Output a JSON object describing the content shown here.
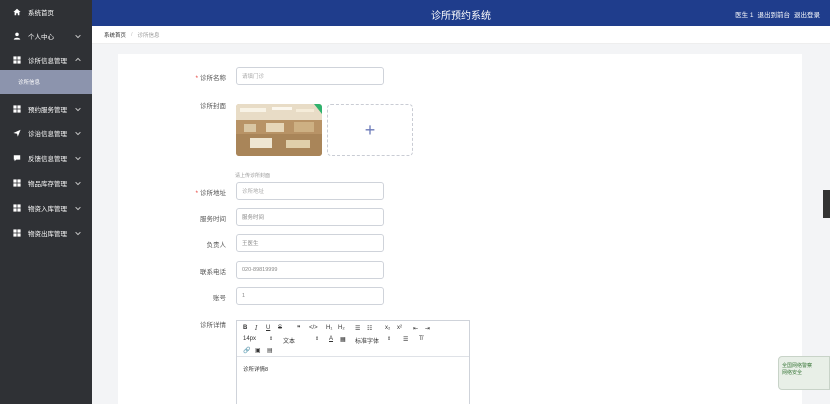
{
  "header": {
    "title": "诊所预约系统",
    "user": "医生 1",
    "to_frontend": "退出到前台",
    "logout": "退出登录"
  },
  "sidebar": {
    "items": [
      {
        "label": "系统首页",
        "icon": "home-icon"
      },
      {
        "label": "个人中心",
        "icon": "user-icon"
      },
      {
        "label": "诊所信息管理",
        "icon": "grid-icon"
      },
      {
        "label": "预约服务管理",
        "icon": "grid-icon"
      },
      {
        "label": "诊治信息管理",
        "icon": "send-icon"
      },
      {
        "label": "反馈信息管理",
        "icon": "chat-icon"
      },
      {
        "label": "物品库存管理",
        "icon": "grid-icon"
      },
      {
        "label": "物资入库管理",
        "icon": "grid-icon"
      },
      {
        "label": "物资出库管理",
        "icon": "grid-icon"
      }
    ],
    "sub_active": "诊所信息"
  },
  "breadcrumb": {
    "first": "系统首页",
    "current": "诊所信息"
  },
  "form": {
    "name_label": "诊所名称",
    "name_value": "请填门诊",
    "cover_label": "诊所封面",
    "upload_hint": "请上传诊所封面",
    "address_label": "诊所地址",
    "address_value": "诊所地址",
    "hours_label": "服务时间",
    "hours_value": "服务时间",
    "manager_label": "负责人",
    "manager_value": "王医生",
    "phone_label": "联系电话",
    "phone_value": "020-89819999",
    "account_label": "账号",
    "account_value": "1",
    "detail_label": "诊所详情",
    "detail_content": "诊所详情8"
  },
  "editor": {
    "font_size": "14px",
    "text_type": "文本",
    "font_family": "标准字体"
  },
  "widget": {
    "line1": "全国网络警察",
    "line2": "网络安全"
  }
}
